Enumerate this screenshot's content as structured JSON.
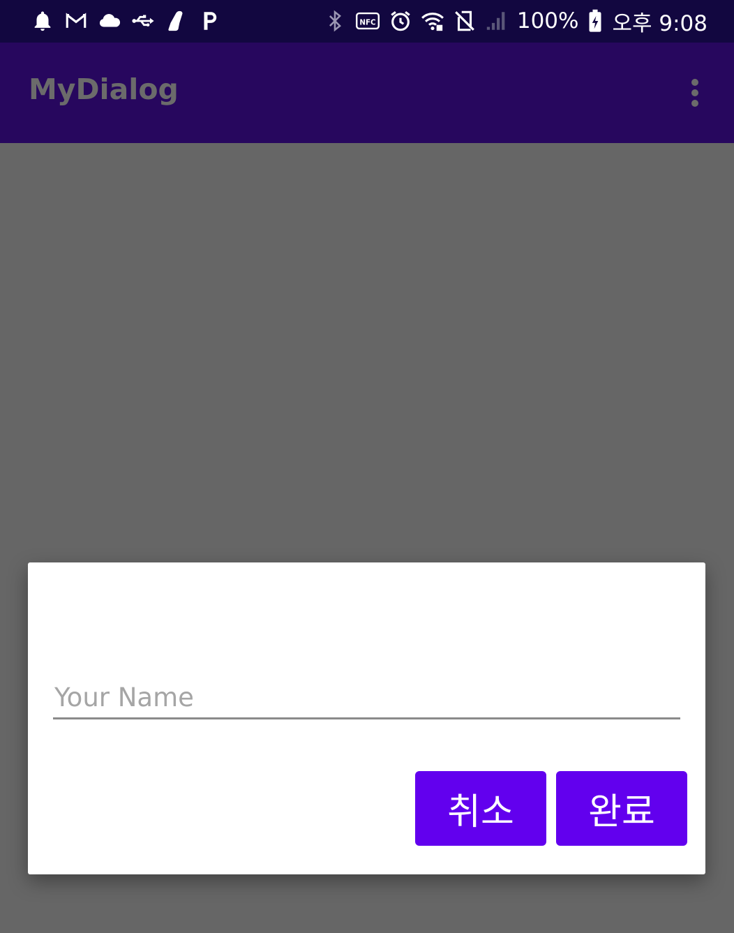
{
  "status_bar": {
    "left_icons": [
      "bell-icon",
      "gmail-icon",
      "cloud-icon",
      "usb-icon",
      "shoe-icon",
      "p-icon"
    ],
    "right_icons": [
      "bluetooth-icon",
      "nfc-icon",
      "alarm-icon",
      "wifi-icon",
      "no-sim-icon",
      "signal-icon",
      "battery-icon"
    ],
    "battery": "100%",
    "time": "오후 9:08"
  },
  "app_bar": {
    "title": "MyDialog",
    "menu_icon": "more-vert-icon"
  },
  "dialog": {
    "input_value": "",
    "input_placeholder": "Your Name",
    "cancel_label": "취소",
    "done_label": "완료"
  },
  "colors": {
    "status_bar": "#120740",
    "app_bar": "#27075e",
    "scrim": "#666666",
    "dialog_bg": "#ffffff",
    "button": "#6200ee",
    "button_text": "#ffffff",
    "placeholder": "#a5a5a5"
  }
}
